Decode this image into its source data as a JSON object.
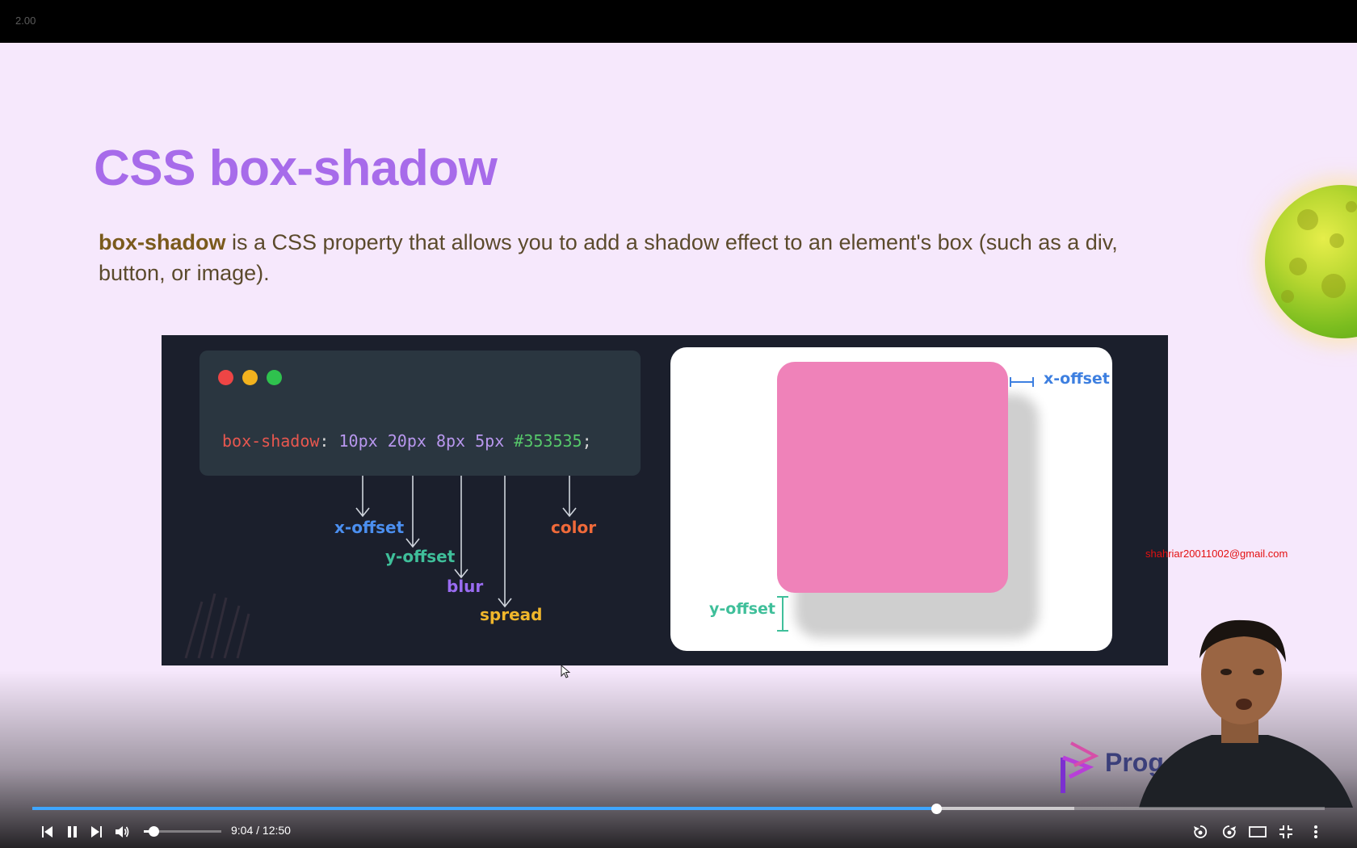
{
  "player": {
    "speed_label": "2.00",
    "time_current": "9:04",
    "time_total": "12:50",
    "time_display": "9:04 / 12:50",
    "progress_fraction": 0.6994,
    "buffer_fraction": 0.8063,
    "volume_fraction": 0.12,
    "accent_color": "#3ea6ff"
  },
  "slide": {
    "title": "CSS box-shadow",
    "desc_bold": "box-shadow",
    "desc_rest": " is a CSS property that allows you to add a shadow effect to an element's box (such as a div, button, or image).",
    "background": "#f6e8fc",
    "title_color": "#a76bea"
  },
  "diagram": {
    "code_property": "box-shadow",
    "code_colon": ":",
    "code_values": [
      "10px",
      "20px",
      "8px",
      "5px"
    ],
    "code_color": "#353535",
    "code_semicolon": ";",
    "labels": {
      "x_offset": "x-offset",
      "y_offset": "y-offset",
      "blur": "blur",
      "spread": "spread",
      "color": "color"
    },
    "demo_labels": {
      "x_offset": "x-offset",
      "y_offset": "y-offset"
    },
    "traffic_lights": [
      "#ee4545",
      "#f2b21e",
      "#2fc24e"
    ]
  },
  "overlay": {
    "watermark_email": "shahriar20011002@gmail.com",
    "logo_text": "Prog"
  },
  "icons": [
    "previous-icon",
    "pause-icon",
    "next-icon",
    "volume-icon",
    "rewind-10-icon",
    "forward-10-icon",
    "theater-mode-icon",
    "exit-fullscreen-icon",
    "more-options-icon",
    "mouse-cursor-icon",
    "logo-icon"
  ]
}
